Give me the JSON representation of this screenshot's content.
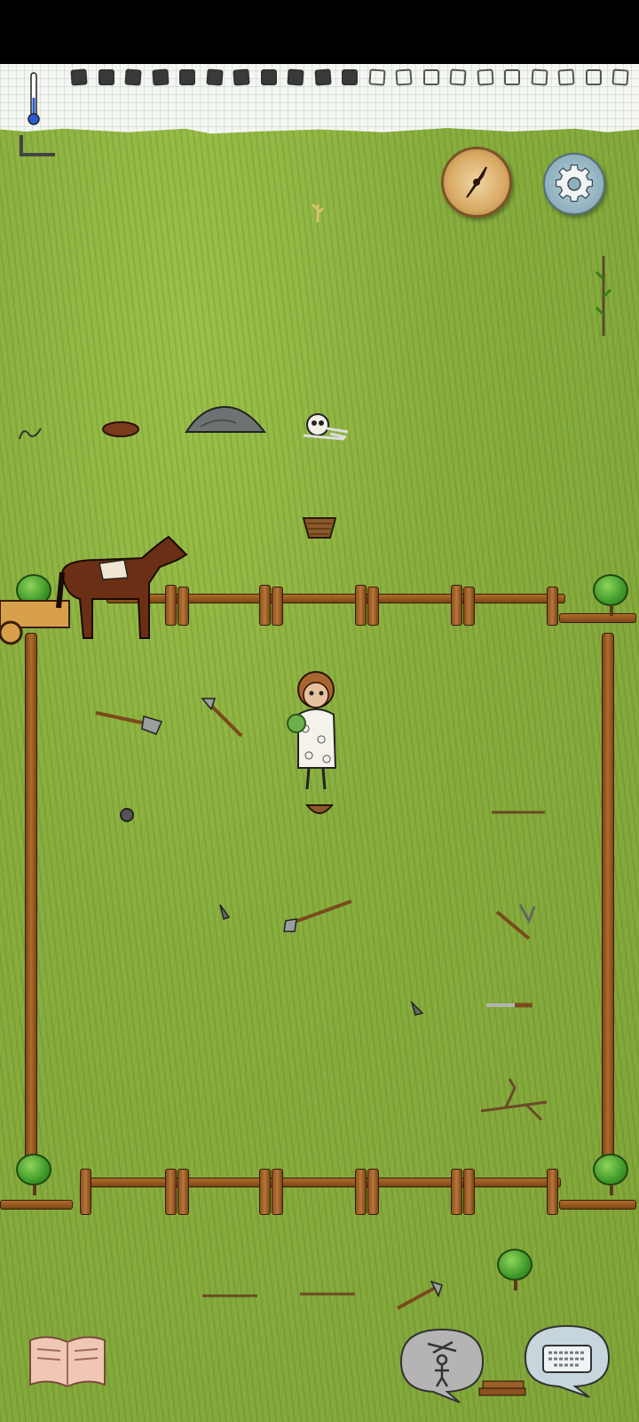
{
  "hud": {
    "hunger_boxes": [
      "full",
      "full",
      "full",
      "full",
      "full",
      "full",
      "full",
      "full",
      "full",
      "full",
      "full",
      "empty",
      "empty",
      "empty",
      "empty",
      "empty",
      "empty",
      "empty",
      "empty",
      "empty",
      "empty",
      "empty"
    ],
    "temperature_icon": "thermometer-icon"
  },
  "buttons": {
    "compass": {
      "icon": "compass-icon"
    },
    "settings": {
      "icon": "gear-icon"
    },
    "journal": {
      "icon": "open-book-icon"
    },
    "emote": {
      "icon": "puppet-speech-bubble-icon"
    },
    "keyboard_chat": {
      "icon": "keyboard-speech-bubble-icon"
    }
  },
  "colors": {
    "grass": "#88ad3e",
    "fence_wood": "#9a5a22",
    "hunger_full": "#3a3a3a",
    "compass_face": "#d8aa64",
    "settings_face": "#8fb0bf"
  }
}
